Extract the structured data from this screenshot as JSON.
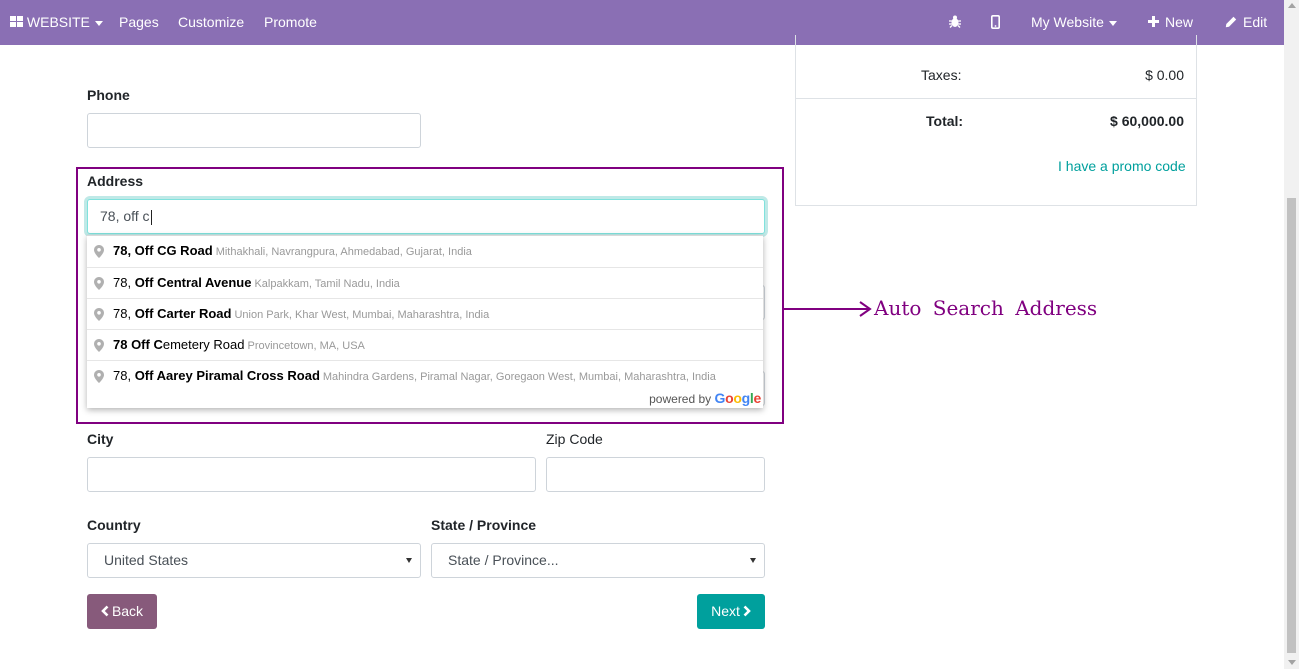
{
  "topbar": {
    "website_label": "WEBSITE",
    "pages_label": "Pages",
    "customize_label": "Customize",
    "promote_label": "Promote",
    "site_label": "My Website",
    "new_label": "New",
    "edit_label": "Edit"
  },
  "form": {
    "phone_label": "Phone",
    "phone_value": "",
    "address_label": "Address",
    "address_value": "78, off c",
    "city_label": "City",
    "city_value": "",
    "zip_label": "Zip Code",
    "zip_value": "",
    "country_label": "Country",
    "country_value": "United States",
    "state_label": "State / Province",
    "state_value": "State / Province..."
  },
  "autocomplete": {
    "items": [
      {
        "prefix": "",
        "bold1": "78, Off CG Road",
        "rest": "",
        "secondary": "Mithakhali, Navrangpura, Ahmedabad, Gujarat, India"
      },
      {
        "prefix": "78, ",
        "bold1": "Off Central Avenue",
        "rest": "",
        "secondary": "Kalpakkam, Tamil Nadu, India"
      },
      {
        "prefix": "78, ",
        "bold1": "Off Carter Road",
        "rest": "",
        "secondary": "Union Park, Khar West, Mumbai, Maharashtra, India"
      },
      {
        "prefix": "",
        "bold1": "78 Off C",
        "rest": "emetery Road",
        "secondary": "Provincetown, MA, USA"
      },
      {
        "prefix": "78, ",
        "bold1": "Off Aarey Piramal Cross Road",
        "rest": "",
        "secondary": "Mahindra Gardens, Piramal Nagar, Goregaon West, Mumbai, Maharashtra, India"
      }
    ],
    "powered_by": "powered by",
    "google": "Google"
  },
  "annotation": {
    "text": "Auto Search Address",
    "color": "#800080"
  },
  "summary": {
    "taxes_label": "Taxes:",
    "taxes_value": "$ 0.00",
    "total_label": "Total:",
    "total_value": "$ 60,000.00",
    "promo_label": "I have a promo code"
  },
  "buttons": {
    "back_label": "Back",
    "next_label": "Next"
  },
  "colors": {
    "topbar": "#8a6fb4",
    "back_button": "#875a7b",
    "next_button": "#00a09d",
    "accent": "#00a09d"
  }
}
